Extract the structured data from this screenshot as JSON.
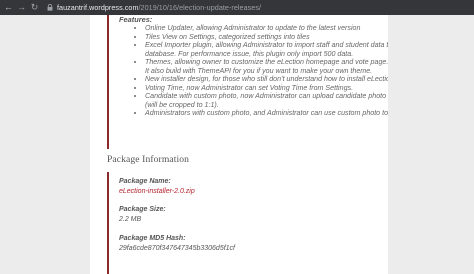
{
  "browser": {
    "url_domain": "fauzantrif.wordpress.com",
    "url_path": "/2019/10/16/election-update-releases/"
  },
  "features": {
    "title": "Features:",
    "items": [
      {
        "lines": [
          "Online Updater, allowing Administrator to update to the latest version"
        ]
      },
      {
        "lines": [
          "Tiles View on Settings, categorized settings into tiles"
        ]
      },
      {
        "lines": [
          "Excel Importer plugin, allowing Administrator to import staff and student data to",
          "database. For performance issue, this plugin only import 500 data."
        ]
      },
      {
        "lines": [
          "Themes, allowing owner to customize the eLection homepage and vote page.",
          "It also build with ThemeAPI for you if you want to make your own theme."
        ]
      },
      {
        "lines": [
          "New installer design, for those who still don’t understand how to install eLection."
        ]
      },
      {
        "lines": [
          "Voting Time, now Administrator can set Voting Time from Settings."
        ]
      },
      {
        "lines": [
          "Candidate with custom photo, now Administrator can upload candidate photo",
          "(will be cropped to 1:1)."
        ]
      },
      {
        "lines": [
          "Administrators with custom photo, and Administrator can use custom photo too."
        ]
      }
    ]
  },
  "package": {
    "title": "Package Information",
    "name_label": "Package Name:",
    "name_value": "eLection-installer-2.0.zip",
    "size_label": "Package Size:",
    "size_value": "2.2 MB",
    "hash_label": "Package MD5 Hash:",
    "hash_value": "29fa6cde870f347647345b3306d5f1cf"
  },
  "colors": {
    "accent": "#8b2a2a",
    "link": "#b5232d",
    "side_bg": "#ececec",
    "chrome_bg": "#35363a"
  }
}
